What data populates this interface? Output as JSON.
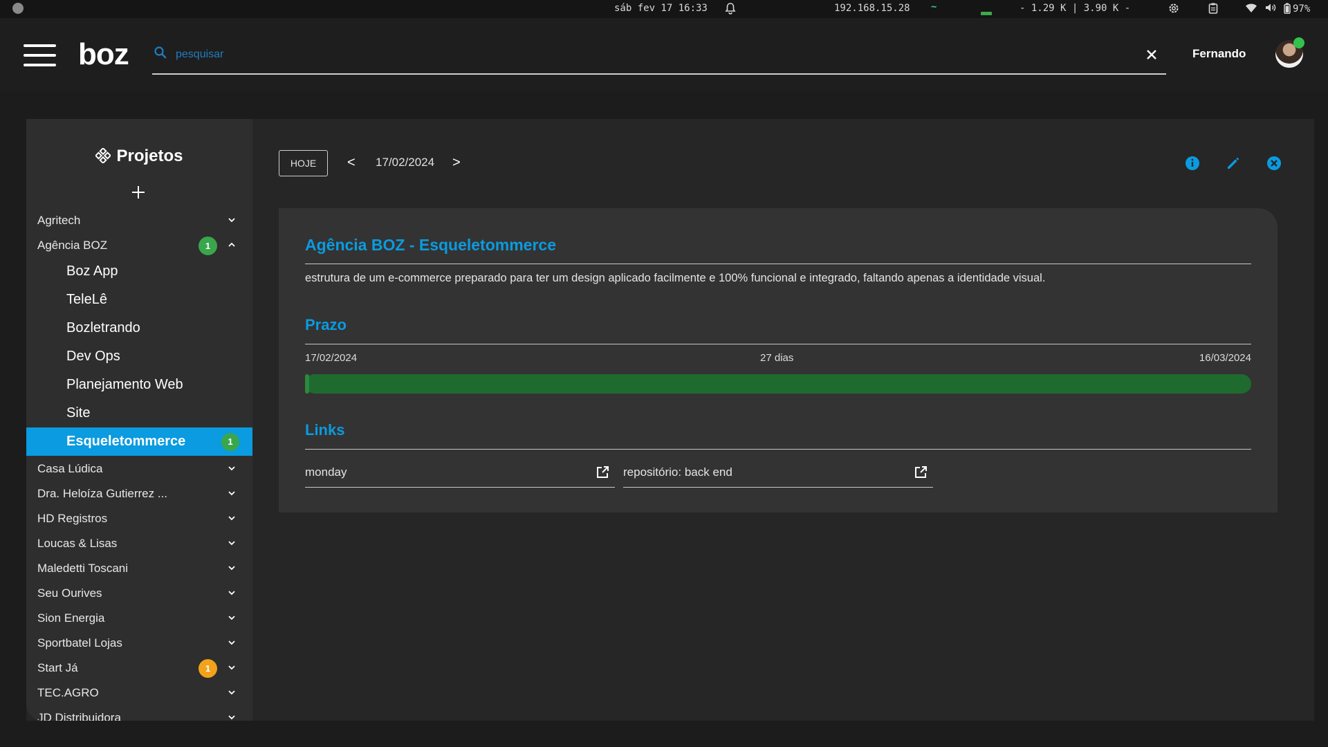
{
  "system_bar": {
    "clock": "sáb fev 17 16:33",
    "ip": "192.168.15.28",
    "network": "- 1.29 K | 3.90 K -",
    "battery": "97%"
  },
  "header": {
    "logo": "boz",
    "search_placeholder": "pesquisar",
    "search_value": "",
    "username": "Fernando"
  },
  "sidebar": {
    "title": "Projetos",
    "items_before": [
      {
        "label": "Agritech",
        "badge": "",
        "expanded": false
      }
    ],
    "group": {
      "label": "Agência BOZ",
      "badge": "1",
      "badge_color": "#3aa64b",
      "expanded": true
    },
    "subitems": [
      {
        "label": "Boz App",
        "badge": ""
      },
      {
        "label": "TeleLê",
        "badge": ""
      },
      {
        "label": "Bozletrando",
        "badge": ""
      },
      {
        "label": "Dev Ops",
        "badge": ""
      },
      {
        "label": "Planejamento Web",
        "badge": ""
      },
      {
        "label": "Site",
        "badge": ""
      },
      {
        "label": "Esqueletommerce",
        "badge": "1",
        "active": true
      }
    ],
    "items_after": [
      {
        "label": "Casa Lúdica",
        "badge": ""
      },
      {
        "label": "Dra. Heloíza Gutierrez ...",
        "badge": ""
      },
      {
        "label": "HD Registros",
        "badge": ""
      },
      {
        "label": "Loucas & Lisas",
        "badge": ""
      },
      {
        "label": "Maledetti Toscani",
        "badge": ""
      },
      {
        "label": "Seu Ourives",
        "badge": ""
      },
      {
        "label": "Sion Energia",
        "badge": ""
      },
      {
        "label": "Sportbatel Lojas",
        "badge": ""
      },
      {
        "label": "Start Já",
        "badge": "1",
        "badge_color": "#f2a31b"
      },
      {
        "label": "TEC.AGRO",
        "badge": ""
      },
      {
        "label": "JD Distribuidora",
        "badge": ""
      }
    ]
  },
  "toolbar": {
    "today_label": "HOJE",
    "prev_label": "<",
    "date": "17/02/2024",
    "next_label": ">",
    "icons": [
      "info-icon",
      "edit-icon",
      "close-circle-icon"
    ],
    "accent": "#0a9be0"
  },
  "project": {
    "title": "Agência BOZ - Esqueletommerce",
    "description": "estrutura de um e-commerce preparado para ter um design aplicado facilmente e 100% funcional e integrado, faltando apenas a identidade visual.",
    "deadline": {
      "section_title": "Prazo",
      "start": "17/02/2024",
      "duration": "27 dias",
      "end": "16/03/2024",
      "progress_fraction": 0.004
    },
    "links": {
      "section_title": "Links",
      "items": [
        {
          "label": "monday"
        },
        {
          "label": "repositório: back end"
        }
      ]
    }
  }
}
